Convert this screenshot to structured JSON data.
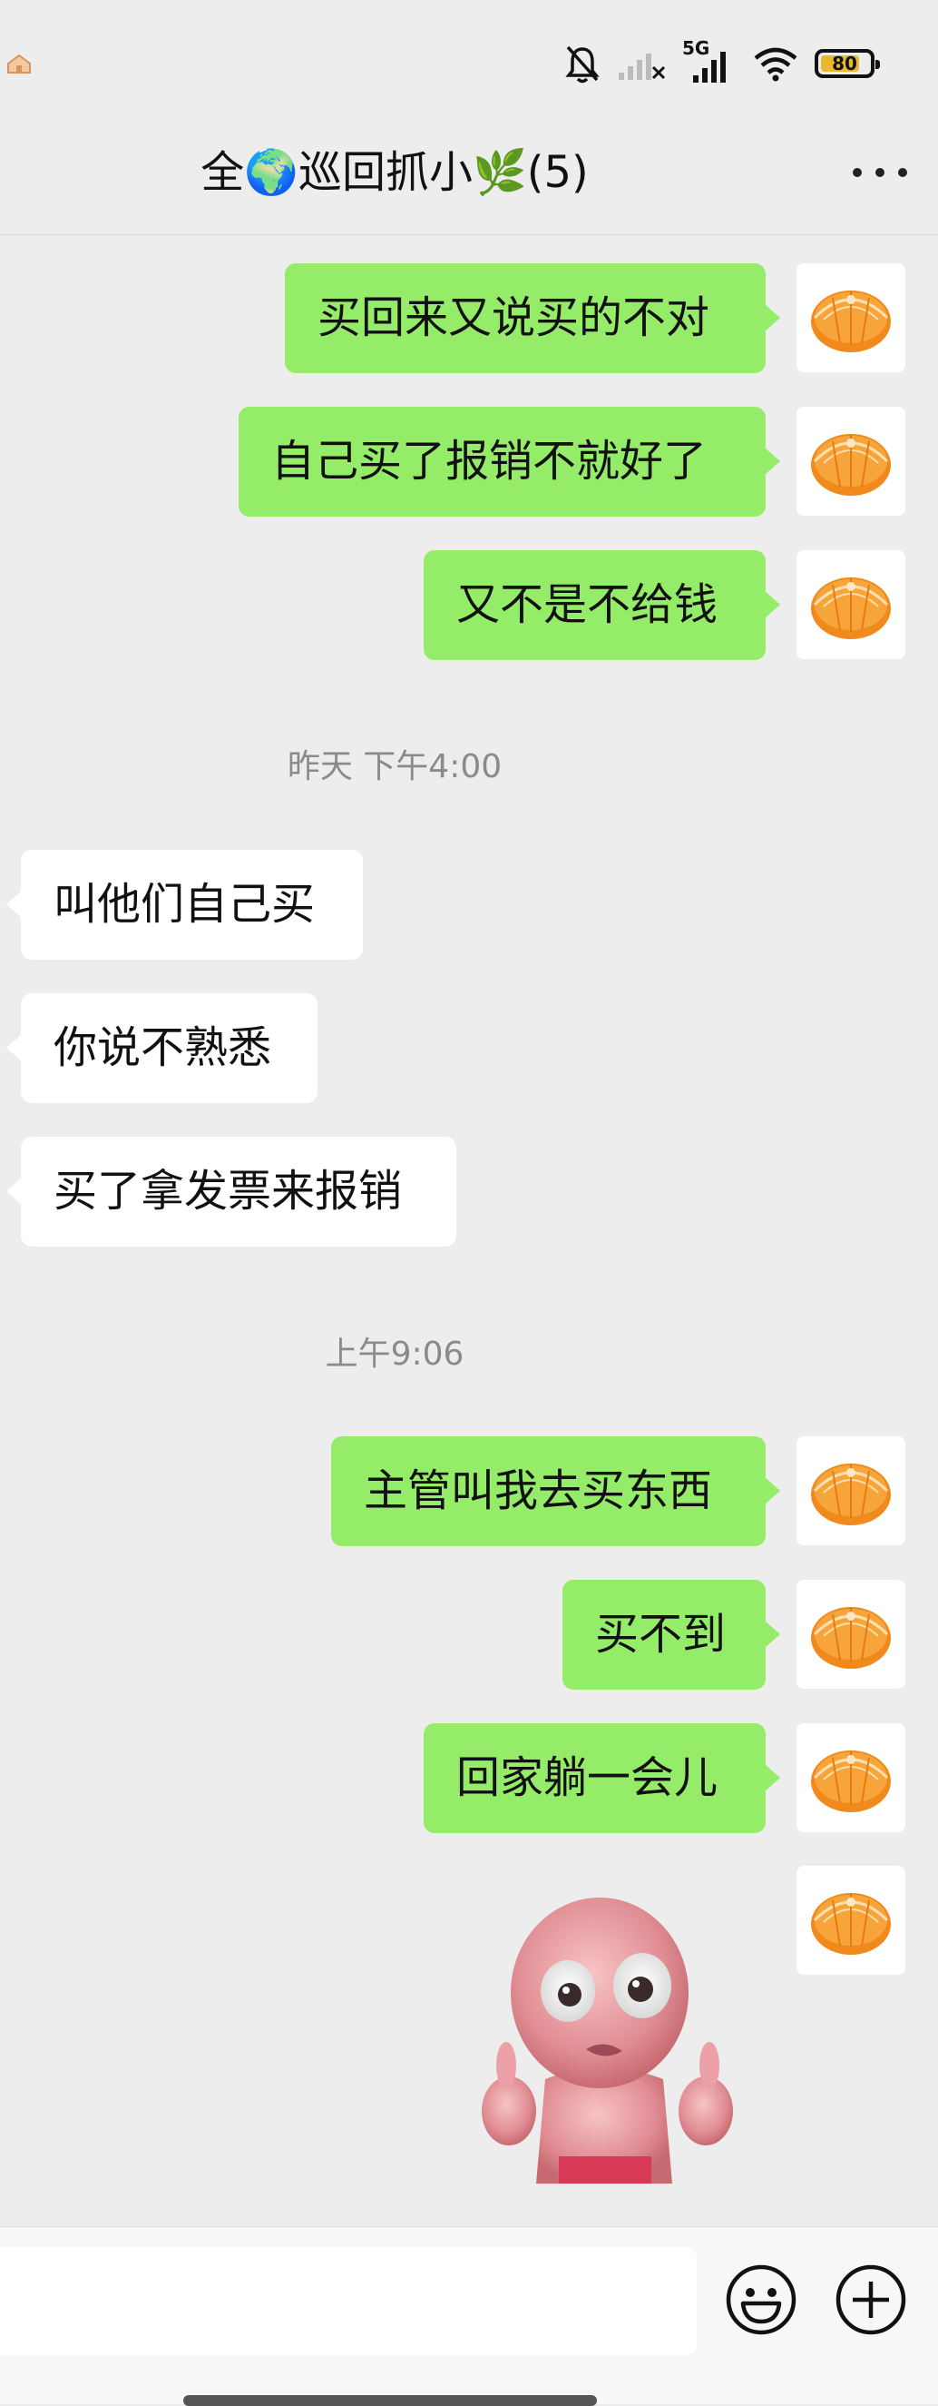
{
  "status_bar": {
    "battery": "80",
    "network": "5G"
  },
  "chat": {
    "title": "全🌍巡回抓小🌿(5)"
  },
  "messages": [
    {
      "side": "out",
      "text": "买回来又说买的不对"
    },
    {
      "side": "out",
      "text": "自己买了报销不就好了"
    },
    {
      "side": "out",
      "text": "又不是不给钱"
    },
    {
      "type": "time",
      "text": "昨天 下午4:00"
    },
    {
      "side": "in",
      "text": "叫他们自己买"
    },
    {
      "side": "in",
      "text": "你说不熟悉"
    },
    {
      "side": "in",
      "text": "买了拿发票来报销"
    },
    {
      "type": "time",
      "text": "上午9:06"
    },
    {
      "side": "out",
      "text": "主管叫我去买东西"
    },
    {
      "side": "out",
      "text": "买不到"
    },
    {
      "side": "out",
      "text": "回家躺一会儿"
    },
    {
      "side": "out",
      "type": "sticker",
      "icon": "pink-creature-thumbs-up-sticker"
    }
  ],
  "colors": {
    "outgoing_bubble": "#95ec69",
    "incoming_bubble": "#ffffff",
    "background": "#ededed"
  },
  "icons": {
    "avatar": "mandarin-orange-icon",
    "more": "more-dots-icon",
    "emoji": "emoji-icon",
    "add": "plus-icon"
  }
}
